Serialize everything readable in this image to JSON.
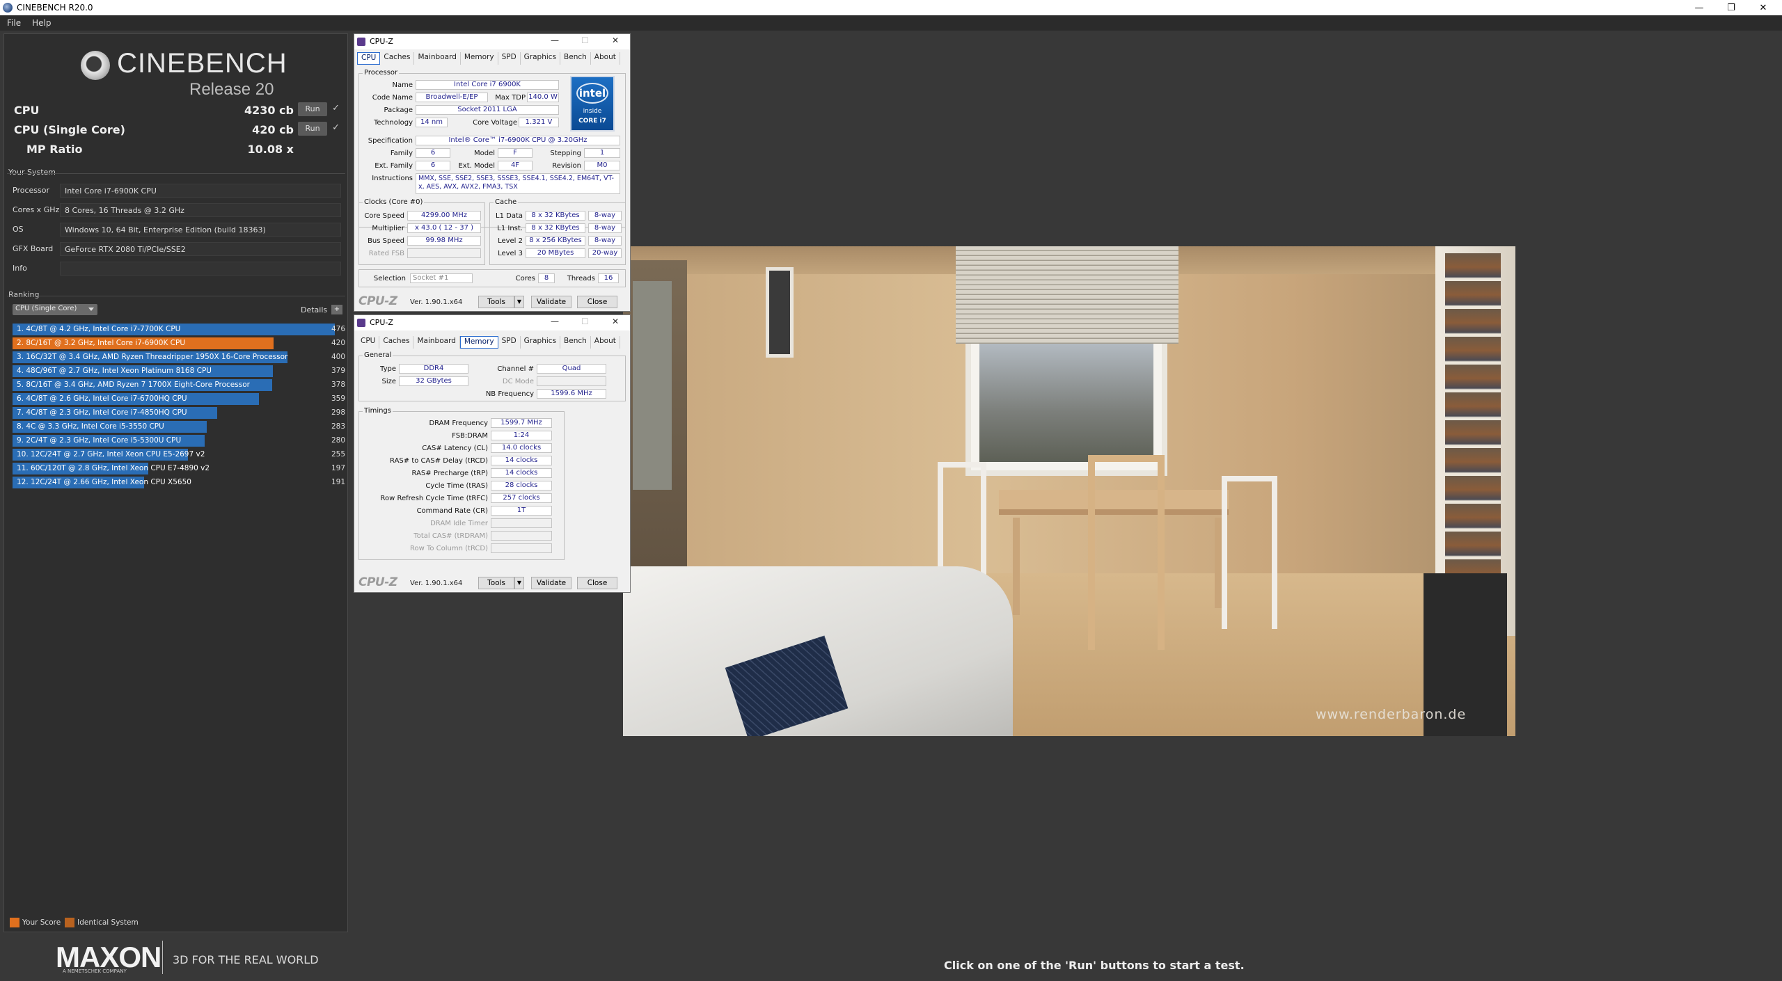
{
  "app": {
    "title": "CINEBENCH R20.0",
    "menu": [
      "File",
      "Help"
    ],
    "controls": {
      "minimize": "—",
      "restore": "❐",
      "close": "✕"
    }
  },
  "logo": {
    "name": "CINEBENCH",
    "release": "Release 20"
  },
  "scores": [
    {
      "label": "CPU",
      "value": "4230 cb",
      "run": "Run",
      "check": "✓"
    },
    {
      "label": "CPU (Single Core)",
      "value": "420 cb",
      "run": "Run",
      "check": "✓"
    },
    {
      "label": "MP Ratio",
      "value": "10.08 x"
    }
  ],
  "system": {
    "title": "Your System",
    "rows": [
      {
        "key": "Processor",
        "value": "Intel Core i7-6900K CPU"
      },
      {
        "key": "Cores x GHz",
        "value": "8 Cores, 16 Threads @ 3.2 GHz"
      },
      {
        "key": "OS",
        "value": "Windows 10, 64 Bit, Enterprise Edition (build 18363)"
      },
      {
        "key": "GFX Board",
        "value": "GeForce RTX 2080 Ti/PCIe/SSE2"
      },
      {
        "key": "Info",
        "value": ""
      }
    ]
  },
  "ranking": {
    "title": "Ranking",
    "select": "CPU (Single Core)",
    "details": "Details",
    "max": 476,
    "items": [
      {
        "label": "1. 4C/8T @ 4.2 GHz, Intel Core i7-7700K CPU",
        "score": 476,
        "score_text": "476",
        "kind": "other"
      },
      {
        "label": "2. 8C/16T @ 3.2 GHz, Intel Core i7-6900K CPU",
        "score": 420,
        "score_text": "420",
        "kind": "your"
      },
      {
        "label": "3. 16C/32T @ 3.4 GHz, AMD Ryzen Threadripper 1950X 16-Core Processor",
        "score": 400,
        "score_text": "400",
        "kind": "other"
      },
      {
        "label": "4. 48C/96T @ 2.7 GHz, Intel Xeon Platinum 8168 CPU",
        "score": 379,
        "score_text": "379",
        "kind": "other"
      },
      {
        "label": "5. 8C/16T @ 3.4 GHz, AMD Ryzen 7 1700X Eight-Core Processor",
        "score": 378,
        "score_text": "378",
        "kind": "other"
      },
      {
        "label": "6. 4C/8T @ 2.6 GHz, Intel Core i7-6700HQ CPU",
        "score": 359,
        "score_text": "359",
        "kind": "other"
      },
      {
        "label": "7. 4C/8T @ 2.3 GHz, Intel Core i7-4850HQ CPU",
        "score": 298,
        "score_text": "298",
        "kind": "other"
      },
      {
        "label": "8. 4C @ 3.3 GHz, Intel Core i5-3550 CPU",
        "score": 283,
        "score_text": "283",
        "kind": "other"
      },
      {
        "label": "9. 2C/4T @ 2.3 GHz, Intel Core i5-5300U CPU",
        "score": 280,
        "score_text": "280",
        "kind": "other"
      },
      {
        "label": "10. 12C/24T @ 2.7 GHz, Intel Xeon CPU E5-2697 v2",
        "score": 255,
        "score_text": "255",
        "kind": "other"
      },
      {
        "label": "11. 60C/120T @ 2.8 GHz, Intel Xeon CPU E7-4890 v2",
        "score": 197,
        "score_text": "197",
        "kind": "other"
      },
      {
        "label": "12. 12C/24T @ 2.66 GHz, Intel Xeon CPU X5650",
        "score": 191,
        "score_text": "191",
        "kind": "other"
      }
    ],
    "legend": [
      {
        "label": "Your Score",
        "color": "#e0701e"
      },
      {
        "label": "Identical System",
        "color": "#b9621f"
      }
    ]
  },
  "colors": {
    "bar_blue": "#2a6db5",
    "bar_orange": "#e0701e"
  },
  "maxon": {
    "brand": "MAXON",
    "sub": "A NEMETSCHEK COMPANY",
    "slogan": "3D FOR THE REAL WORLD"
  },
  "hint": "Click on one of the 'Run' buttons to start a test.",
  "render": {
    "watermark": "www.renderbaron.de"
  },
  "cpuz_cpu": {
    "title": "CPU-Z",
    "tabs": [
      "CPU",
      "Caches",
      "Mainboard",
      "Memory",
      "SPD",
      "Graphics",
      "Bench",
      "About"
    ],
    "active_tab": "CPU",
    "processor_title": "Processor",
    "name_label": "Name",
    "name": "Intel Core i7 6900K",
    "codename_label": "Code Name",
    "codename": "Broadwell-E/EP",
    "maxtdp_label": "Max TDP",
    "maxtdp": "140.0 W",
    "package_label": "Package",
    "package": "Socket 2011 LGA",
    "technology_label": "Technology",
    "technology": "14 nm",
    "corevoltage_label": "Core Voltage",
    "corevoltage": "1.321 V",
    "spec_label": "Specification",
    "spec": "Intel® Core™ i7-6900K CPU @ 3.20GHz",
    "family_label": "Family",
    "family": "6",
    "model_label": "Model",
    "model": "F",
    "stepping_label": "Stepping",
    "stepping": "1",
    "extfamily_label": "Ext. Family",
    "extfamily": "6",
    "extmodel_label": "Ext. Model",
    "extmodel": "4F",
    "revision_label": "Revision",
    "revision": "M0",
    "instructions_label": "Instructions",
    "instructions": "MMX, SSE, SSE2, SSE3, SSSE3, SSE4.1, SSE4.2, EM64T, VT-x, AES, AVX, AVX2, FMA3, TSX",
    "clocks_title": "Clocks (Core #0)",
    "corespeed_label": "Core Speed",
    "corespeed": "4299.00 MHz",
    "multiplier_label": "Multiplier",
    "multiplier": "x 43.0 ( 12 - 37 )",
    "busspeed_label": "Bus Speed",
    "busspeed": "99.98 MHz",
    "ratedfsb_label": "Rated FSB",
    "cache_title": "Cache",
    "l1data_label": "L1 Data",
    "l1data": "8 x 32 KBytes",
    "l1data_way": "8-way",
    "l1inst_label": "L1 Inst.",
    "l1inst": "8 x 32 KBytes",
    "l1inst_way": "8-way",
    "level2_label": "Level 2",
    "level2": "8 x 256 KBytes",
    "level2_way": "8-way",
    "level3_label": "Level 3",
    "level3": "20 MBytes",
    "level3_way": "20-way",
    "selection_label": "Selection",
    "selection": "Socket #1",
    "cores_label": "Cores",
    "cores": "8",
    "threads_label": "Threads",
    "threads": "16",
    "intel": {
      "logo": "intel",
      "inside": "inside",
      "core": "CORE i7"
    },
    "footer": {
      "logo": "CPU-Z",
      "version": "Ver. 1.90.1.x64",
      "tools": "Tools",
      "validate": "Validate",
      "close": "Close"
    }
  },
  "cpuz_mem": {
    "title": "CPU-Z",
    "tabs": [
      "CPU",
      "Caches",
      "Mainboard",
      "Memory",
      "SPD",
      "Graphics",
      "Bench",
      "About"
    ],
    "active_tab": "Memory",
    "general_title": "General",
    "type_label": "Type",
    "type": "DDR4",
    "size_label": "Size",
    "size": "32 GBytes",
    "channel_label": "Channel #",
    "channel": "Quad",
    "dcmode_label": "DC Mode",
    "nbfreq_label": "NB Frequency",
    "nbfreq": "1599.6 MHz",
    "timings_title": "Timings",
    "timings": [
      {
        "label": "DRAM Frequency",
        "value": "1599.7 MHz",
        "dim": false
      },
      {
        "label": "FSB:DRAM",
        "value": "1:24",
        "dim": false
      },
      {
        "label": "CAS# Latency (CL)",
        "value": "14.0 clocks",
        "dim": false
      },
      {
        "label": "RAS# to CAS# Delay (tRCD)",
        "value": "14 clocks",
        "dim": false
      },
      {
        "label": "RAS# Precharge (tRP)",
        "value": "14 clocks",
        "dim": false
      },
      {
        "label": "Cycle Time (tRAS)",
        "value": "28 clocks",
        "dim": false
      },
      {
        "label": "Row Refresh Cycle Time (tRFC)",
        "value": "257 clocks",
        "dim": false
      },
      {
        "label": "Command Rate (CR)",
        "value": "1T",
        "dim": false
      },
      {
        "label": "DRAM Idle Timer",
        "value": "",
        "dim": true
      },
      {
        "label": "Total CAS# (tRDRAM)",
        "value": "",
        "dim": true
      },
      {
        "label": "Row To Column (tRCD)",
        "value": "",
        "dim": true
      }
    ],
    "footer": {
      "logo": "CPU-Z",
      "version": "Ver. 1.90.1.x64",
      "tools": "Tools",
      "validate": "Validate",
      "close": "Close"
    }
  }
}
